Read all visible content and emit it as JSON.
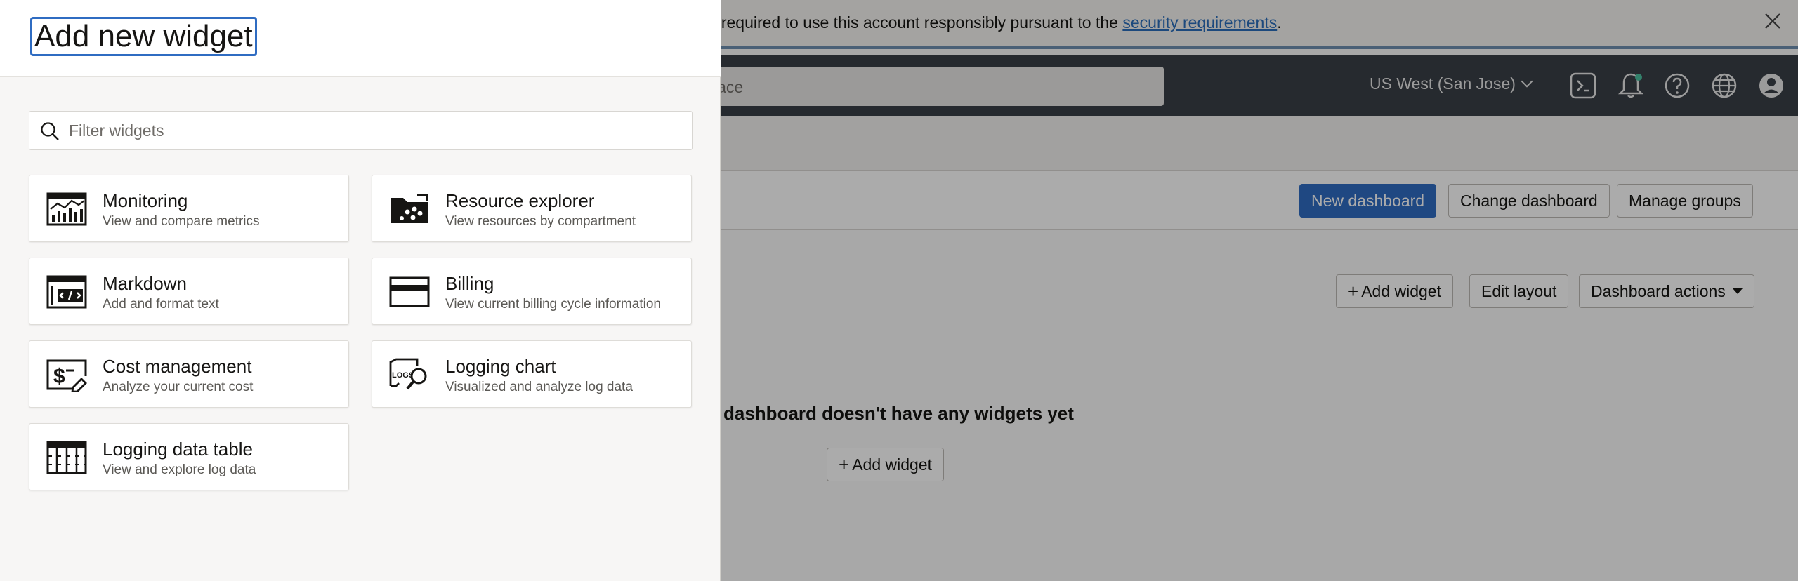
{
  "banner": {
    "text": "re required to use this account responsibly pursuant to the ",
    "link": "security requirements",
    "suffix": "."
  },
  "topbar": {
    "search_placeholder": "lace",
    "region": "US West (San Jose)"
  },
  "dashboard": {
    "new_dashboard": "New dashboard",
    "change_dashboard": "Change dashboard",
    "manage_groups": "Manage groups",
    "add_widget": "Add widget",
    "edit_layout": "Edit layout",
    "dashboard_actions": "Dashboard actions",
    "empty_message": "dashboard doesn't have any widgets yet",
    "empty_add_widget": "Add widget"
  },
  "panel": {
    "title": "Add new widget",
    "filter_placeholder": "Filter widgets",
    "widgets": [
      {
        "title": "Monitoring",
        "desc": "View and compare metrics",
        "icon": "monitoring-chart-icon"
      },
      {
        "title": "Resource explorer",
        "desc": "View resources by compartment",
        "icon": "folder-explorer-icon"
      },
      {
        "title": "Markdown",
        "desc": "Add and format text",
        "icon": "markdown-code-icon"
      },
      {
        "title": "Billing",
        "desc": "View current billing cycle information",
        "icon": "credit-card-icon"
      },
      {
        "title": "Cost management",
        "desc": "Analyze your current cost",
        "icon": "cost-dollar-icon"
      },
      {
        "title": "Logging chart",
        "desc": "Visualized and analyze log data",
        "icon": "logs-search-icon"
      },
      {
        "title": "Logging data table",
        "desc": "View and explore log data",
        "icon": "data-table-icon"
      }
    ]
  },
  "colors": {
    "accent": "#2f6cc2",
    "topbar": "#3a3f46",
    "link": "#2a6ebb"
  }
}
